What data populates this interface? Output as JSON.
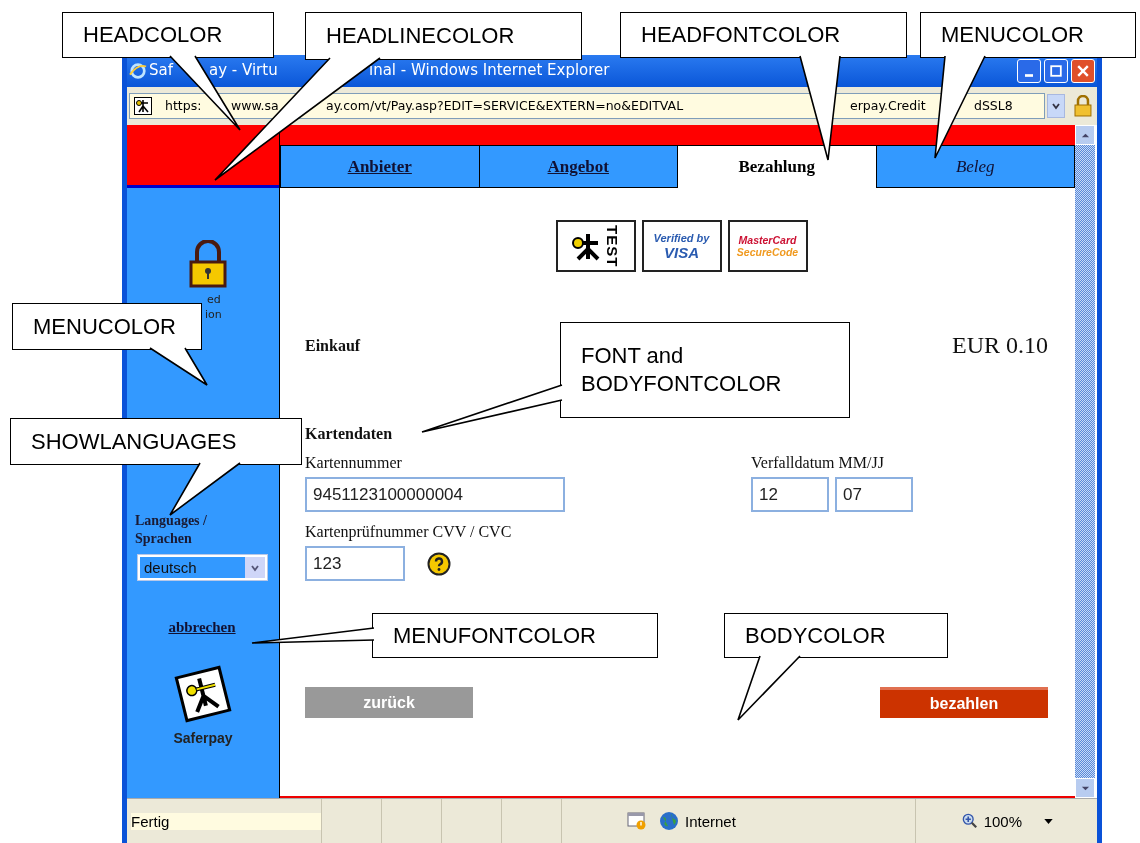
{
  "callouts": [
    {
      "text": "HEADCOLOR"
    },
    {
      "text": "HEADLINECOLOR"
    },
    {
      "text": "HEADFONTCOLOR"
    },
    {
      "text": "MENUCOLOR"
    },
    {
      "text": "MENUCOLOR"
    },
    {
      "text": "FONT and BODYFONTCOLOR"
    },
    {
      "text": "SHOWLANGUAGES"
    },
    {
      "text": "MENUFONTCOLOR"
    },
    {
      "text": "BODYCOLOR"
    }
  ],
  "window": {
    "title_parts": [
      "Saf",
      "ay - Virtu",
      "inal - Windows Internet Explorer"
    ],
    "address_parts": [
      "https:",
      "www.sa",
      "ay.com/vt/Pay.asp?EDIT=SERVICE&EXTERN=no&EDITVAL",
      "erpay.Credit",
      "dSSL8"
    ]
  },
  "menu": {
    "lock_label_parts": [
      "ed",
      "ion"
    ],
    "languages_label": "Languages / Sprachen",
    "language": "deutsch",
    "cancel_link": "abbrechen",
    "logo_caption": "Saferpay"
  },
  "tabs": [
    {
      "label": "Anbieter",
      "selected": false,
      "italic": false
    },
    {
      "label": "Angebot",
      "selected": false,
      "italic": false
    },
    {
      "label": "Bezahlung",
      "selected": true,
      "italic": false
    },
    {
      "label": "Beleg",
      "selected": false,
      "italic": true
    }
  ],
  "body": {
    "badges": [
      {
        "kind": "test",
        "lines": [
          "TEST"
        ]
      },
      {
        "kind": "visa",
        "lines": [
          "Verified by",
          "VISA"
        ]
      },
      {
        "kind": "mastercard",
        "lines": [
          "MasterCard",
          "SecureCode"
        ]
      }
    ],
    "purchase_label": "Einkauf",
    "amount": "EUR 0.10",
    "section": "Kartendaten",
    "card_number": {
      "label": "Kartennummer",
      "value": "9451123100000004"
    },
    "expiry": {
      "label": "Verfalldatum MM/JJ",
      "values": [
        "12",
        "07"
      ]
    },
    "cvv": {
      "label": "Kartenprüfnummer CVV / CVC",
      "value": "123"
    },
    "back_button": "zurück",
    "pay_button": "bezahlen"
  },
  "status_bar": {
    "text": "Fertig",
    "zone": "Internet",
    "zoom": "100%"
  }
}
